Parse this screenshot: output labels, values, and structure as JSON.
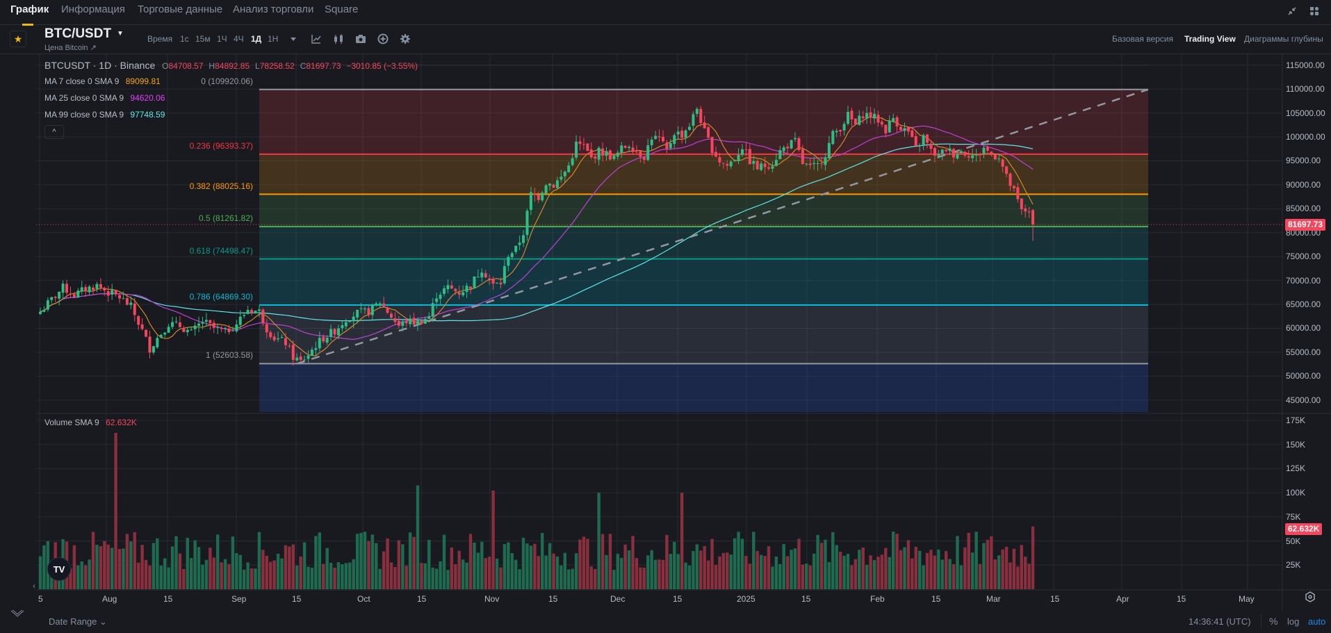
{
  "nav": {
    "tabs": [
      {
        "label": "График",
        "active": true
      },
      {
        "label": "Информация",
        "active": false
      },
      {
        "label": "Торговые данные",
        "active": false
      },
      {
        "label": "Анализ торговли",
        "active": false
      },
      {
        "label": "Square",
        "active": false
      }
    ],
    "icons": [
      "collapse-icon",
      "layout-grid-icon"
    ]
  },
  "toolbar": {
    "symbol": "BTC/USDT",
    "subtitle": "Цена Bitcoin ↗",
    "timeframes_label": "Время",
    "timeframes": [
      "1с",
      "15м",
      "1Ч",
      "4Ч",
      "1Д",
      "1Н"
    ],
    "active_timeframe": "1Д",
    "view_tabs": [
      "Базовая версия",
      "Trading View",
      "Диаграммы глубины"
    ],
    "active_view": "Trading View"
  },
  "legend": {
    "title": "BTCUSDT · 1D · Binance",
    "o_label": "O",
    "o": "84708.57",
    "h_label": "H",
    "h": "84892.85",
    "l_label": "L",
    "l": "78258.52",
    "c_label": "C",
    "c": "81697.73",
    "change": "−3010.85 (−3.55%)",
    "ma": [
      {
        "label": "MA 7 close 0 SMA 9",
        "value": "89099.81",
        "color": "#f7a600"
      },
      {
        "label": "MA 25 close 0 SMA 9",
        "value": "94620.06",
        "color": "#e040fb"
      },
      {
        "label": "MA 99 close 0 SMA 9",
        "value": "97748.59",
        "color": "#5ee7ea"
      }
    ],
    "collapse": "^"
  },
  "fib": {
    "levels": [
      {
        "label": "0 (109920.06)",
        "price": 109920.06,
        "color": "#9598a1",
        "fill": "#432229"
      },
      {
        "label": "0.236 (96393.37)",
        "price": 96393.37,
        "color": "#f23645",
        "fill": "#46341e"
      },
      {
        "label": "0.382 (88025.16)",
        "price": 88025.16,
        "color": "#ff9800",
        "fill": "#24362b"
      },
      {
        "label": "0.5 (81261.82)",
        "price": 81261.82,
        "color": "#4caf50",
        "fill": "#17333a"
      },
      {
        "label": "0.618 (74498.47)",
        "price": 74498.47,
        "color": "#089981",
        "fill": "#133843"
      },
      {
        "label": "0.786 (64869.30)",
        "price": 64869.3,
        "color": "#00bcd4",
        "fill": "#2a2e39"
      },
      {
        "label": "1 (52603.58)",
        "price": 52603.58,
        "color": "#9598a1",
        "fill": "#1c2849"
      }
    ]
  },
  "volume": {
    "label": "Volume SMA 9",
    "value": "62.632K"
  },
  "last_price_tag": "81697.73",
  "volume_tag": "62.632K",
  "bottom": {
    "date_range": "Date Range ⌄",
    "clock": "14:36:41 (UTC)",
    "pct": "%",
    "log": "log",
    "auto": "auto"
  },
  "colors": {
    "up": "#2ebd85",
    "down": "#f6465d",
    "vol_up": "#1f6b50",
    "vol_down": "#8a2f3e",
    "accent": "#f0b90b"
  },
  "chart_data": {
    "type": "candlestick",
    "title": "BTCUSDT · 1D · Binance",
    "price_axis": {
      "ticks": [
        115000,
        110000,
        105000,
        100000,
        95000,
        90000,
        85000,
        80000,
        75000,
        70000,
        65000,
        60000,
        55000,
        50000,
        45000
      ],
      "tick_labels": [
        "115000.00",
        "110000.00",
        "105000.00",
        "100000.00",
        "95000.00",
        "90000.00",
        "85000.00",
        "80000.00",
        "75000.00",
        "70000.00",
        "65000.00",
        "60000.00",
        "55000.00",
        "50000.00",
        "45000.00"
      ],
      "range": [
        42500,
        117000
      ]
    },
    "volume_axis": {
      "ticks": [
        175000,
        150000,
        125000,
        100000,
        75000,
        50000,
        25000
      ],
      "tick_labels": [
        "175K",
        "150K",
        "125K",
        "100K",
        "75K",
        "50K",
        "25K"
      ],
      "range": [
        0,
        180000
      ]
    },
    "time_axis": {
      "labels": [
        "5",
        "Aug",
        "15",
        "Sep",
        "15",
        "Oct",
        "15",
        "Nov",
        "15",
        "Dec",
        "15",
        "2025",
        "15",
        "Feb",
        "15",
        "Mar",
        "15",
        "Apr",
        "15",
        "May"
      ]
    },
    "close_path": [
      [
        0,
        63500
      ],
      [
        3,
        66000
      ],
      [
        6,
        68500
      ],
      [
        9,
        67000
      ],
      [
        12,
        68200
      ],
      [
        15,
        69000
      ],
      [
        18,
        67500
      ],
      [
        21,
        66500
      ],
      [
        24,
        64500
      ],
      [
        27,
        59500
      ],
      [
        29,
        55800
      ],
      [
        31,
        58000
      ],
      [
        34,
        61000
      ],
      [
        37,
        60500
      ],
      [
        40,
        59000
      ],
      [
        43,
        61500
      ],
      [
        46,
        60000
      ],
      [
        49,
        59200
      ],
      [
        52,
        61000
      ],
      [
        55,
        64000
      ],
      [
        58,
        63500
      ],
      [
        60,
        60000
      ],
      [
        62,
        58000
      ],
      [
        65,
        57000
      ],
      [
        67,
        54000
      ],
      [
        69,
        53000
      ],
      [
        71,
        54500
      ],
      [
        73,
        56500
      ],
      [
        75,
        58000
      ],
      [
        78,
        59500
      ],
      [
        81,
        62000
      ],
      [
        84,
        63200
      ],
      [
        87,
        63500
      ],
      [
        90,
        65500
      ],
      [
        93,
        62500
      ],
      [
        95,
        60500
      ],
      [
        97,
        61500
      ],
      [
        100,
        61200
      ],
      [
        103,
        62500
      ],
      [
        105,
        67000
      ],
      [
        108,
        68500
      ],
      [
        111,
        67500
      ],
      [
        114,
        69000
      ],
      [
        117,
        72500
      ],
      [
        120,
        69000
      ],
      [
        122,
        69500
      ],
      [
        124,
        75500
      ],
      [
        126,
        76500
      ],
      [
        128,
        80000
      ],
      [
        130,
        88000
      ],
      [
        132,
        87500
      ],
      [
        134,
        90500
      ],
      [
        136,
        90000
      ],
      [
        138,
        91500
      ],
      [
        140,
        94000
      ],
      [
        142,
        98500
      ],
      [
        144,
        98000
      ],
      [
        146,
        95500
      ],
      [
        148,
        97000
      ],
      [
        150,
        96500
      ],
      [
        152,
        95500
      ],
      [
        154,
        97500
      ],
      [
        156,
        98500
      ],
      [
        158,
        97000
      ],
      [
        160,
        96000
      ],
      [
        162,
        100000
      ],
      [
        164,
        99500
      ],
      [
        166,
        97000
      ],
      [
        168,
        101000
      ],
      [
        170,
        100500
      ],
      [
        172,
        102500
      ],
      [
        174,
        106000
      ],
      [
        176,
        101000
      ],
      [
        178,
        97500
      ],
      [
        180,
        95000
      ],
      [
        182,
        94000
      ],
      [
        184,
        95500
      ],
      [
        186,
        98000
      ],
      [
        188,
        95000
      ],
      [
        190,
        93500
      ],
      [
        192,
        94000
      ],
      [
        194,
        94500
      ],
      [
        196,
        97000
      ],
      [
        198,
        98300
      ],
      [
        200,
        99000
      ],
      [
        202,
        94500
      ],
      [
        204,
        93500
      ],
      [
        206,
        94000
      ],
      [
        208,
        96500
      ],
      [
        210,
        100500
      ],
      [
        212,
        102000
      ],
      [
        214,
        104500
      ],
      [
        216,
        102500
      ],
      [
        218,
        104800
      ],
      [
        220,
        104500
      ],
      [
        222,
        103500
      ],
      [
        224,
        101500
      ],
      [
        226,
        104000
      ],
      [
        228,
        102000
      ],
      [
        230,
        101000
      ],
      [
        232,
        97500
      ],
      [
        234,
        100000
      ],
      [
        236,
        97000
      ],
      [
        238,
        96000
      ],
      [
        240,
        97500
      ],
      [
        242,
        96500
      ],
      [
        244,
        97000
      ],
      [
        246,
        96500
      ],
      [
        248,
        95800
      ],
      [
        250,
        97800
      ],
      [
        252,
        96200
      ],
      [
        254,
        96000
      ],
      [
        256,
        91500
      ],
      [
        258,
        88500
      ],
      [
        260,
        84500
      ],
      [
        262,
        84700
      ],
      [
        263,
        81697
      ]
    ],
    "ma7_last": 89099.81,
    "ma25_last": 94620.06,
    "ma99_last": 97748.59,
    "volume_sma9_last": 62632,
    "last_close": 81697.73
  }
}
